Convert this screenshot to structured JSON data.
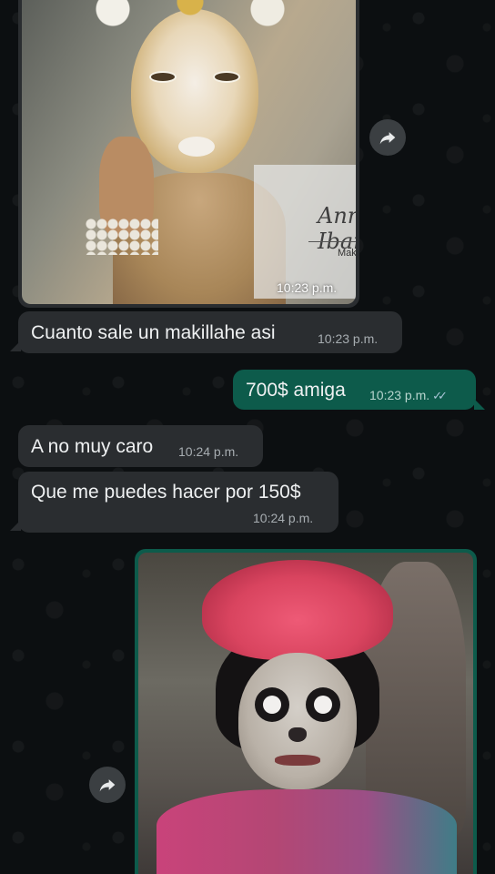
{
  "messages": [
    {
      "id": "m1",
      "type": "image",
      "direction": "in",
      "time": "10:23 p.m.",
      "watermark_title": "Annaly Ibarra",
      "watermark_subtitle": "Makeup artist"
    },
    {
      "id": "m2",
      "type": "text",
      "direction": "in",
      "text": "Cuanto sale un makillahe asi",
      "time": "10:23 p.m."
    },
    {
      "id": "m3",
      "type": "text",
      "direction": "out",
      "text": "700$ amiga",
      "time": "10:23 p.m.",
      "read_status": "read",
      "ticks": "✓✓"
    },
    {
      "id": "m4",
      "type": "text",
      "direction": "in",
      "text": "A no muy caro",
      "time": "10:24 p.m."
    },
    {
      "id": "m5",
      "type": "text",
      "direction": "in",
      "text": "Que me puedes hacer por 150$",
      "time": "10:24 p.m."
    },
    {
      "id": "m6",
      "type": "image",
      "direction": "out"
    }
  ],
  "icons": {
    "forward": "forward-arrow-icon",
    "read_receipt": "double-check-icon"
  },
  "colors": {
    "background": "#0b0e10",
    "incoming_bubble": "#2a2d30",
    "outgoing_bubble": "#0d5b4b",
    "read_tick": "#a8c5d6"
  }
}
